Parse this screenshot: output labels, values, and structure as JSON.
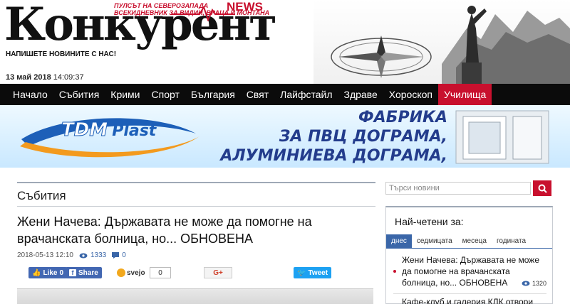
{
  "header": {
    "logo": "Конкурент",
    "tagline_line1": "ПУЛСЪТ НА СЕВЕРОЗАПАДА",
    "tagline_line2": "ВСЕКИДНЕВНИК ЗА ВИДИН, ВРАЦА И МОНТАНА",
    "news": "NEWS",
    "write_us": "НАПИШЕТЕ НОВИНИТЕ С НАС!",
    "date": "13 май 2018",
    "time": "14:09:37"
  },
  "nav": {
    "items": [
      "Начало",
      "Събития",
      "Крими",
      "Спорт",
      "България",
      "Свят",
      "Лайфстайл",
      "Здраве",
      "Хороскоп",
      "Училища"
    ],
    "active_index": 9
  },
  "banner": {
    "brand": "TDM",
    "brand_sub": "Plast",
    "line1": "ФАБРИКА",
    "line2": "ЗА ПВЦ ДОГРАМА,",
    "line3": "АЛУМИНИЕВА ДОГРАМА,"
  },
  "article": {
    "section": "Събития",
    "title": "Жени Начева: Държавата не може да помогне на врачанската болница, но... ОБНОВЕНА",
    "datetime": "2018-05-13 12:10",
    "views": "1333",
    "comments": "0"
  },
  "share": {
    "like_label": "Like",
    "like_count": "0",
    "share_label": "Share",
    "svejo_label": "svejo",
    "svejo_count": "0",
    "gplus_label": "G+",
    "tweet_label": "Tweet"
  },
  "sidebar": {
    "search_placeholder": "Търси новини",
    "most_read_title": "Най-четени за:",
    "tabs": [
      "днес",
      "седмицата",
      "месеца",
      "годината"
    ],
    "active_tab": 0,
    "items": [
      {
        "title": "Жени Начева: Държавата не може да помогне на врачанската болница, но... ОБНОВЕНА",
        "views": "1320"
      },
      {
        "title": "Кафе-клуб и галерия КЛК отвори",
        "views": ""
      }
    ]
  },
  "colors": {
    "brand_red": "#c8102e",
    "nav_bg": "#0b0b0b",
    "accent_blue": "#3a66a8"
  }
}
